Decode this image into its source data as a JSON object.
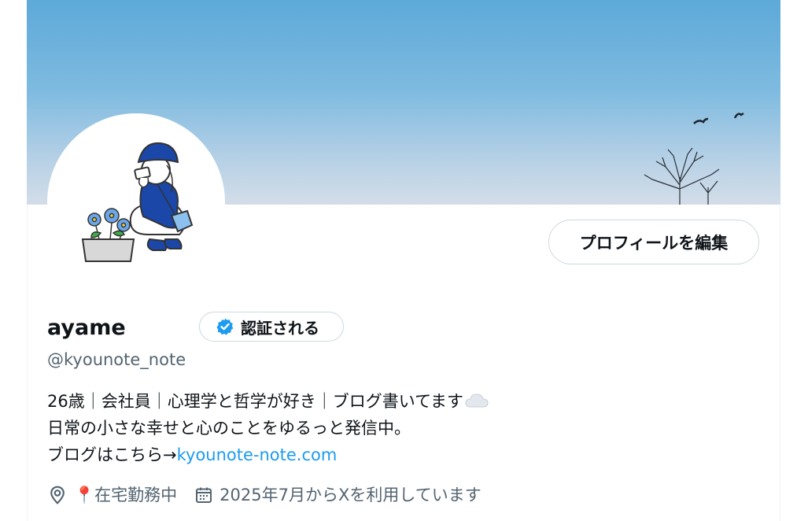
{
  "profile": {
    "display_name": "ayame",
    "handle": "@kyounote_note",
    "verify_label": "認証される",
    "edit_profile_label": "プロフィールを編集",
    "bio": {
      "line1": "26歳｜会社員｜心理学と哲学が好き｜ブログ書いてます",
      "line1_emoji": "cloud",
      "line2": "日常の小さな幸せと心のことをゆるっと発信中。",
      "line3_prefix": "ブログはこちら→",
      "link": "kyounote-note.com"
    },
    "location_pin_emoji": "📍",
    "location": "在宅勤務中",
    "joined": "2025年7月からXを利用しています"
  },
  "icons": {
    "location": "location-pin-icon",
    "calendar": "calendar-icon",
    "verified": "verified-badge-icon"
  },
  "colors": {
    "link": "#1d9bf0",
    "secondary_text": "#536471",
    "primary_text": "#0f1419",
    "avatar_blue": "#1a47a8"
  }
}
